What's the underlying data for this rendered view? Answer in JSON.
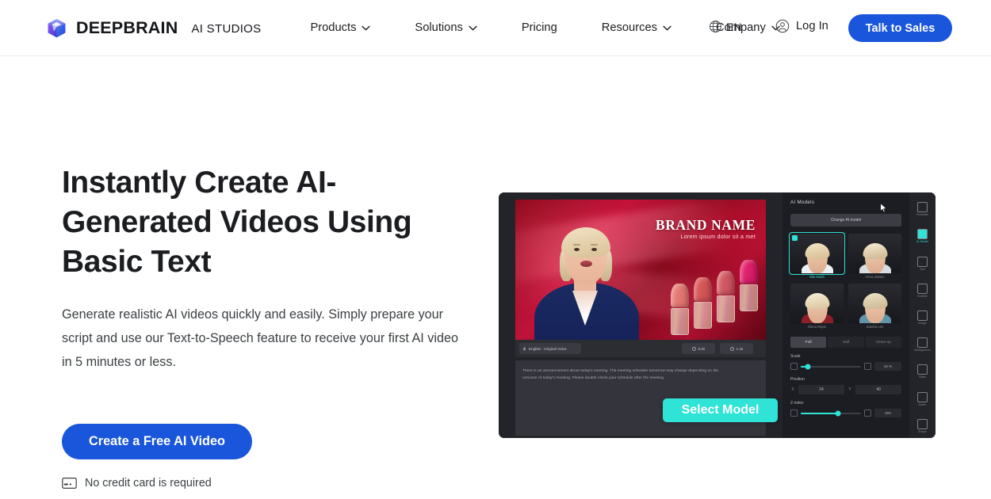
{
  "header": {
    "logo_icon": "cube-logo-icon",
    "brand_name": "DEEPBRAIN",
    "brand_sub": "AI STUDIOS",
    "nav": [
      {
        "label": "Products",
        "has_caret": true
      },
      {
        "label": "Solutions",
        "has_caret": true
      },
      {
        "label": "Pricing",
        "has_caret": false
      },
      {
        "label": "Resources",
        "has_caret": true
      },
      {
        "label": "Company",
        "has_caret": true
      }
    ],
    "language": {
      "label": "EN",
      "icon": "globe-icon"
    },
    "login": {
      "label": "Log In",
      "icon": "user-circle-icon"
    },
    "cta": {
      "label": "Talk to Sales"
    }
  },
  "hero": {
    "headline_line1": "Instantly Create AI-",
    "headline_line2": "Generated Videos Using",
    "headline_line3": "Basic Text",
    "subcopy": "Generate realistic AI videos quickly and easily. Simply prepare your script and use our Text-to-Speech feature to receive your first AI video in 5 minutes or less.",
    "cta": {
      "label": "Create a Free AI Video"
    },
    "note": {
      "label": "No credit card is required",
      "icon": "credit-card-icon"
    }
  },
  "editor": {
    "stage": {
      "brand_title": "BRAND NAME",
      "brand_tagline": "Lorem ipsum dolor sit a met"
    },
    "toolbar": {
      "language_pill": "English - Original Voice",
      "time_pill_1": "0.0s",
      "time_pill_2": "1.4s"
    },
    "script": {
      "line1": "There is an announcement about today's meeting. The meeting schedule tomorrow may change depending on the",
      "line2": "outcome of today's meeting. Please double check your schedule after the meeting."
    },
    "overlay_button": {
      "label": "Select Model"
    },
    "panel": {
      "title": "AI Models",
      "change_button": "Change AI model",
      "models": [
        {
          "name": "Mia Smith",
          "selected": true
        },
        {
          "name": "Anna Jasmin",
          "selected": false
        },
        {
          "name": "Elena Rojas",
          "selected": false
        },
        {
          "name": "Sandra Lee",
          "selected": false
        }
      ],
      "segments": [
        {
          "label": "Full",
          "active": true
        },
        {
          "label": "Half",
          "active": false
        },
        {
          "label": "Close-up",
          "active": false
        }
      ],
      "controls": [
        {
          "label": "Scale",
          "value": "44 %",
          "fill_pct": 12
        },
        {
          "label": "Position",
          "x_axis": "X",
          "x_value": "24",
          "y_axis": "Y",
          "y_value": "40"
        },
        {
          "label": "Z-index",
          "value": "404",
          "fill_pct": 62
        }
      ]
    },
    "rail": [
      {
        "label": "Template",
        "icon": "template-icon",
        "active": false
      },
      {
        "label": "AI Model",
        "icon": "ai-model-icon",
        "active": true
      },
      {
        "label": "Text",
        "icon": "text-icon",
        "active": false
      },
      {
        "label": "Subtitle",
        "icon": "subtitle-icon",
        "active": false
      },
      {
        "label": "Image",
        "icon": "image-icon",
        "active": false
      },
      {
        "label": "Background",
        "icon": "background-icon",
        "active": false
      },
      {
        "label": "Video",
        "icon": "video-icon",
        "active": false
      },
      {
        "label": "Audio",
        "icon": "audio-icon",
        "active": false
      },
      {
        "label": "Shape",
        "icon": "shape-icon",
        "active": false
      }
    ]
  },
  "colors": {
    "brand_blue": "#1a56db",
    "accent_teal": "#2fe3d6",
    "text_dark": "#1b1d21"
  }
}
